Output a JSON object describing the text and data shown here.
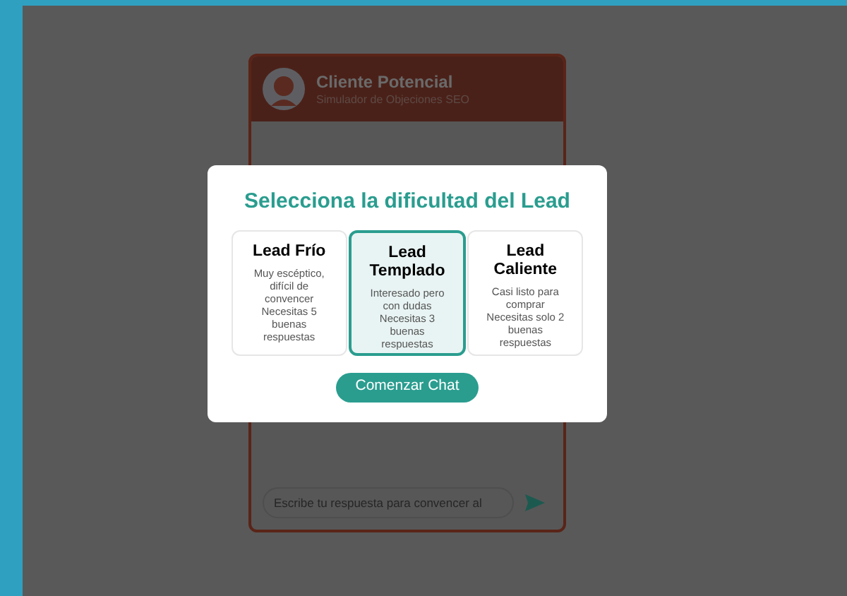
{
  "chat": {
    "title": "Cliente Potencial",
    "subtitle": "Simulador de Objeciones SEO",
    "input": {
      "placeholder": "Escribe tu respuesta para convencer al"
    }
  },
  "modal": {
    "title": "Selecciona la dificultad del Lead",
    "options": [
      {
        "title": "Lead Frío",
        "description": "Muy escéptico, difícil de convencer Necesitas 5 buenas respuestas",
        "selected": false
      },
      {
        "title": "Lead Templado",
        "description": "Interesado pero con dudas Necesitas 3 buenas respuestas",
        "selected": true
      },
      {
        "title": "Lead Caliente",
        "description": "Casi listo para comprar Necesitas solo 2 buenas respuestas",
        "selected": false
      }
    ],
    "button": "Comenzar Chat"
  }
}
